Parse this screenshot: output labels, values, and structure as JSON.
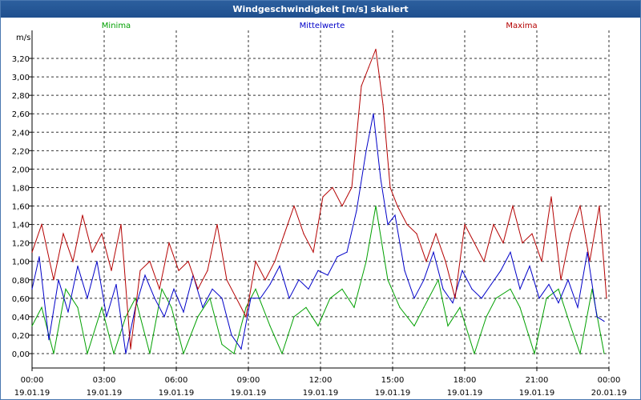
{
  "window": {
    "title": "Windgeschwindigkeit [m/s] skaliert"
  },
  "chart_data": {
    "type": "line",
    "title": "Windgeschwindigkeit [m/s] skaliert",
    "ylabel": "m/s",
    "ylim": [
      0,
      3.4
    ],
    "grid": true,
    "legend_position": "top",
    "xlim": [
      0,
      24
    ],
    "y_ticks": [
      "0,00",
      "0,20",
      "0,40",
      "0,60",
      "0,80",
      "1,00",
      "1,20",
      "1,40",
      "1,60",
      "1,80",
      "2,00",
      "2,20",
      "2,40",
      "2,60",
      "2,80",
      "3,00",
      "3,20"
    ],
    "x_ticks": [
      {
        "time": "00:00",
        "date": "19.01.19"
      },
      {
        "time": "03:00",
        "date": "19.01.19"
      },
      {
        "time": "06:00",
        "date": "19.01.19"
      },
      {
        "time": "09:00",
        "date": "19.01.19"
      },
      {
        "time": "12:00",
        "date": "19.01.19"
      },
      {
        "time": "15:00",
        "date": "19.01.19"
      },
      {
        "time": "18:00",
        "date": "19.01.19"
      },
      {
        "time": "21:00",
        "date": "19.01.19"
      },
      {
        "time": "00:00",
        "date": "20.01.19"
      }
    ],
    "series": [
      {
        "name": "Minima",
        "color": "#00a000",
        "x": [
          0,
          0.4,
          0.9,
          1.4,
          1.9,
          2.3,
          2.9,
          3.4,
          3.9,
          4.3,
          4.9,
          5.4,
          5.8,
          6.3,
          6.9,
          7.4,
          7.9,
          8.4,
          8.9,
          9.3,
          9.9,
          10.4,
          10.9,
          11.4,
          11.9,
          12.4,
          12.9,
          13.4,
          13.9,
          14.3,
          14.8,
          15.3,
          15.9,
          16.3,
          16.9,
          17.3,
          17.8,
          18.4,
          18.9,
          19.3,
          19.9,
          20.3,
          20.9,
          21.4,
          21.9,
          22.4,
          22.8,
          23.3,
          23.8
        ],
        "values": [
          0.3,
          0.5,
          0.0,
          0.7,
          0.5,
          0.0,
          0.5,
          0.0,
          0.4,
          0.6,
          0.0,
          0.7,
          0.5,
          0.0,
          0.4,
          0.6,
          0.1,
          0.0,
          0.5,
          0.7,
          0.3,
          0.0,
          0.4,
          0.5,
          0.3,
          0.6,
          0.7,
          0.5,
          1.0,
          1.6,
          0.8,
          0.5,
          0.3,
          0.5,
          0.8,
          0.3,
          0.5,
          0.0,
          0.4,
          0.6,
          0.7,
          0.5,
          0.0,
          0.6,
          0.7,
          0.3,
          0.0,
          0.7,
          0.0
        ]
      },
      {
        "name": "Mittelwerte",
        "color": "#0000c8",
        "x": [
          0,
          0.3,
          0.7,
          1.1,
          1.5,
          1.9,
          2.3,
          2.7,
          3.1,
          3.5,
          3.9,
          4.3,
          4.7,
          5.1,
          5.5,
          5.9,
          6.3,
          6.7,
          7.1,
          7.5,
          7.9,
          8.3,
          8.7,
          9.1,
          9.5,
          9.9,
          10.3,
          10.7,
          11.1,
          11.5,
          11.9,
          12.3,
          12.7,
          13.1,
          13.5,
          13.9,
          14.2,
          14.5,
          14.8,
          15.1,
          15.5,
          15.9,
          16.3,
          16.7,
          17.1,
          17.5,
          17.9,
          18.3,
          18.7,
          19.1,
          19.5,
          19.9,
          20.3,
          20.7,
          21.1,
          21.5,
          21.9,
          22.3,
          22.7,
          23.1,
          23.5,
          23.8
        ],
        "values": [
          0.7,
          1.05,
          0.15,
          0.8,
          0.45,
          0.95,
          0.6,
          1.0,
          0.4,
          0.75,
          0.0,
          0.5,
          0.85,
          0.6,
          0.4,
          0.7,
          0.45,
          0.85,
          0.5,
          0.7,
          0.6,
          0.2,
          0.05,
          0.6,
          0.6,
          0.75,
          0.95,
          0.6,
          0.8,
          0.7,
          0.9,
          0.85,
          1.05,
          1.1,
          1.55,
          2.2,
          2.6,
          1.9,
          1.4,
          1.5,
          0.9,
          0.6,
          0.8,
          1.1,
          0.7,
          0.55,
          0.9,
          0.7,
          0.6,
          0.75,
          0.9,
          1.1,
          0.7,
          0.95,
          0.6,
          0.75,
          0.55,
          0.8,
          0.5,
          1.1,
          0.4,
          0.35
        ]
      },
      {
        "name": "Maxima",
        "color": "#b40000",
        "x": [
          0,
          0.4,
          0.9,
          1.3,
          1.7,
          2.1,
          2.5,
          2.9,
          3.3,
          3.7,
          4.1,
          4.5,
          4.9,
          5.3,
          5.7,
          6.1,
          6.5,
          6.9,
          7.3,
          7.7,
          8.1,
          8.5,
          8.9,
          9.3,
          9.7,
          10.1,
          10.5,
          10.9,
          11.3,
          11.7,
          12.1,
          12.5,
          12.9,
          13.3,
          13.7,
          14.0,
          14.3,
          14.6,
          14.9,
          15.2,
          15.6,
          16.0,
          16.4,
          16.8,
          17.2,
          17.6,
          18.0,
          18.4,
          18.8,
          19.2,
          19.6,
          20.0,
          20.4,
          20.8,
          21.2,
          21.6,
          22.0,
          22.4,
          22.8,
          23.2,
          23.6,
          23.9
        ],
        "values": [
          1.1,
          1.4,
          0.8,
          1.3,
          1.0,
          1.5,
          1.1,
          1.3,
          0.9,
          1.4,
          0.05,
          0.9,
          1.0,
          0.7,
          1.2,
          0.9,
          1.0,
          0.7,
          0.9,
          1.4,
          0.8,
          0.6,
          0.4,
          1.0,
          0.8,
          1.0,
          1.3,
          1.6,
          1.3,
          1.1,
          1.7,
          1.8,
          1.6,
          1.8,
          2.9,
          3.1,
          3.3,
          2.7,
          1.8,
          1.6,
          1.4,
          1.3,
          1.0,
          1.3,
          1.0,
          0.6,
          1.4,
          1.2,
          1.0,
          1.4,
          1.2,
          1.6,
          1.2,
          1.3,
          1.0,
          1.7,
          0.8,
          1.3,
          1.6,
          1.0,
          1.6,
          0.6
        ]
      }
    ]
  }
}
